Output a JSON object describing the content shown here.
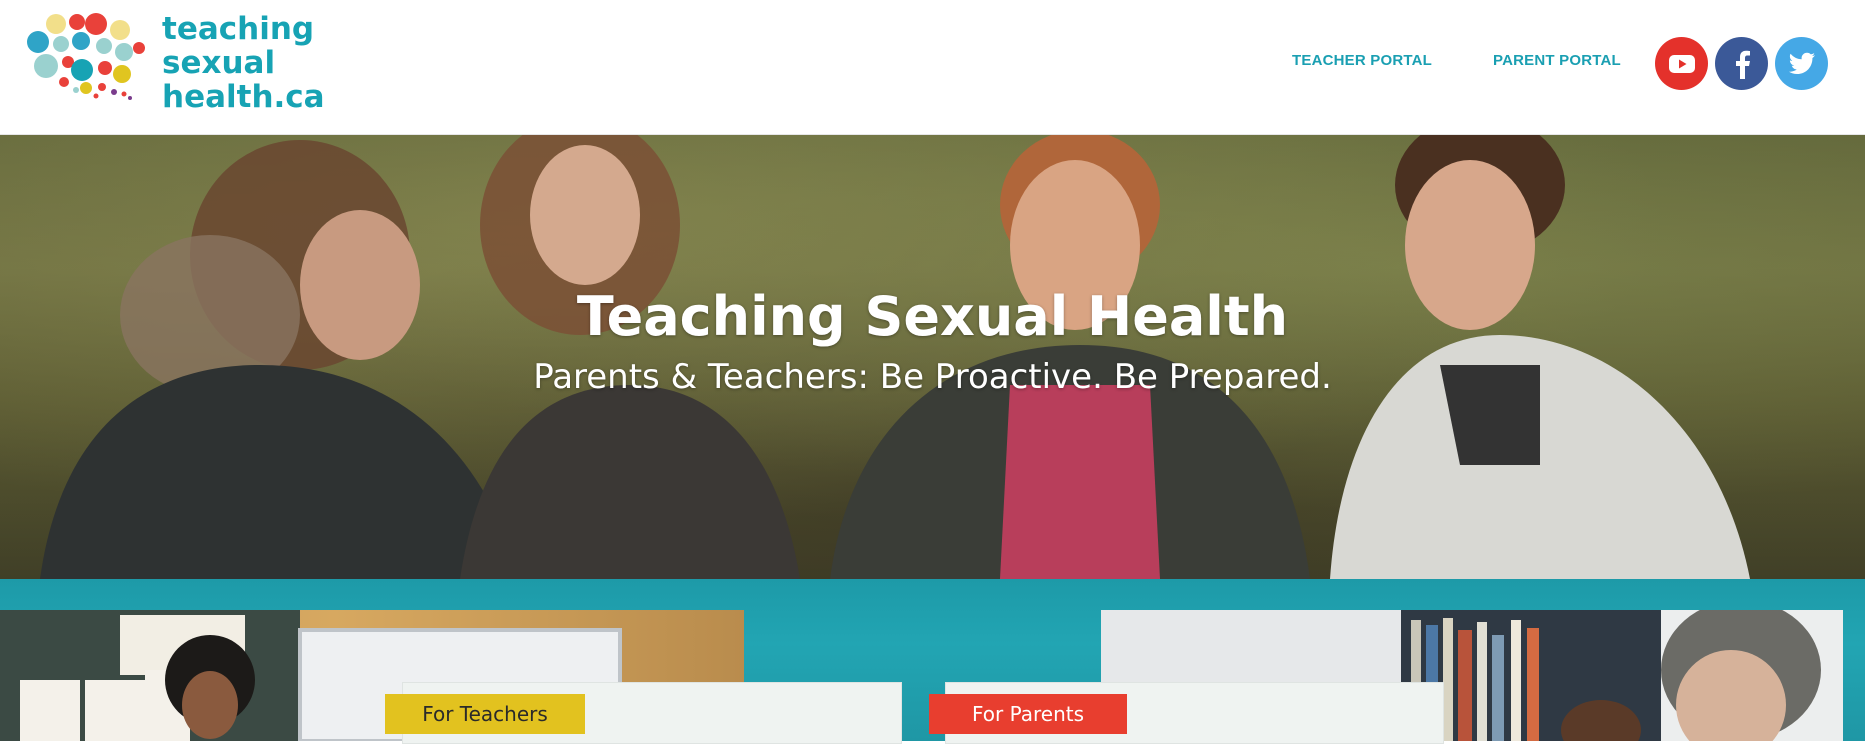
{
  "header": {
    "logo_lines": [
      "teaching",
      "sexual",
      "health.ca"
    ],
    "nav": [
      {
        "label": "TEACHER PORTAL"
      },
      {
        "label": "PARENT PORTAL"
      }
    ],
    "social": [
      {
        "icon": "youtube-icon",
        "color": "#e4312b"
      },
      {
        "icon": "facebook-icon",
        "color": "#3b5998"
      },
      {
        "icon": "twitter-icon",
        "color": "#45a8e6"
      }
    ]
  },
  "hero": {
    "title": "Teaching Sexual Health",
    "subtitle": "Parents & Teachers: Be Proactive. Be Prepared."
  },
  "cards": [
    {
      "label": "For Teachers",
      "color": "#e2c21f"
    },
    {
      "label": "For Parents",
      "color": "#e83e2f"
    }
  ],
  "colors": {
    "brand_teal": "#17a3b4",
    "band_teal": "#22a5b3"
  }
}
